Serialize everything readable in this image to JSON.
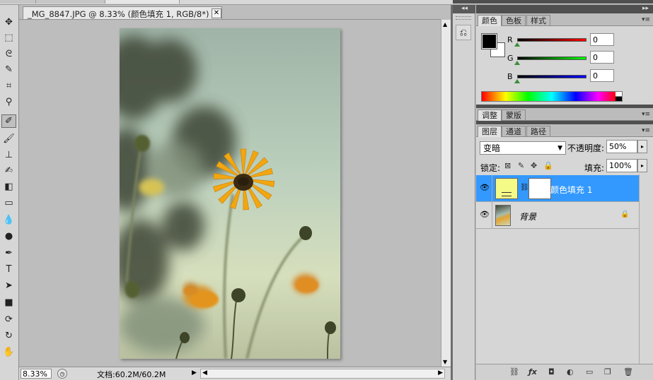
{
  "document": {
    "tab_title": "_MG_8847.JPG @ 8.33% (颜色填充 1, RGB/8*) *",
    "close_glyph": "✕"
  },
  "status": {
    "zoom": "8.33%",
    "doc_info": "文档:60.2M/60.2M"
  },
  "toolbar": {
    "tools": [
      {
        "name": "move-tool-icon",
        "glyph": "✥"
      },
      {
        "name": "marquee-tool-icon",
        "glyph": "⬚"
      },
      {
        "name": "lasso-tool-icon",
        "glyph": "ᘓ"
      },
      {
        "name": "quick-select-tool-icon",
        "glyph": "✎"
      },
      {
        "name": "crop-tool-icon",
        "glyph": "⌗"
      },
      {
        "name": "eyedropper-tool-icon",
        "glyph": "⚲"
      },
      {
        "name": "healing-brush-tool-icon",
        "glyph": "✐"
      },
      {
        "name": "brush-tool-icon",
        "glyph": "🖌"
      },
      {
        "name": "clone-stamp-tool-icon",
        "glyph": "⊥"
      },
      {
        "name": "history-brush-tool-icon",
        "glyph": "✍"
      },
      {
        "name": "eraser-tool-icon",
        "glyph": "◧"
      },
      {
        "name": "gradient-tool-icon",
        "glyph": "▭"
      },
      {
        "name": "blur-tool-icon",
        "glyph": "💧"
      },
      {
        "name": "dodge-tool-icon",
        "glyph": "●"
      },
      {
        "name": "pen-tool-icon",
        "glyph": "✒"
      },
      {
        "name": "type-tool-icon",
        "glyph": "T"
      },
      {
        "name": "path-select-tool-icon",
        "glyph": "➤"
      },
      {
        "name": "shape-tool-icon",
        "glyph": "■"
      },
      {
        "name": "3d-rotate-tool-icon",
        "glyph": "⟳"
      },
      {
        "name": "3d-orbit-tool-icon",
        "glyph": "↻"
      },
      {
        "name": "hand-tool-icon",
        "glyph": "✋"
      }
    ]
  },
  "color_panel": {
    "tabs": [
      "颜色",
      "色板",
      "样式"
    ],
    "channels": [
      {
        "label": "R",
        "value": "0",
        "color": "#ff0000"
      },
      {
        "label": "G",
        "value": "0",
        "color": "#00c000"
      },
      {
        "label": "B",
        "value": "0",
        "color": "#0000ff"
      }
    ]
  },
  "adjust_panel": {
    "tabs": [
      "调整",
      "蒙版"
    ]
  },
  "layers_panel": {
    "tabs": [
      "图层",
      "通道",
      "路径"
    ],
    "blend_mode": "变暗",
    "opacity_label": "不透明度:",
    "opacity_value": "50%",
    "lock_label": "锁定:",
    "fill_label": "填充:",
    "fill_value": "100%",
    "layers": [
      {
        "name": "颜色填充 1",
        "selected": true
      },
      {
        "name": "背景",
        "selected": false
      }
    ]
  },
  "colors": {
    "selection": "#3399ff",
    "fill_swatch": "#f4fb86"
  }
}
